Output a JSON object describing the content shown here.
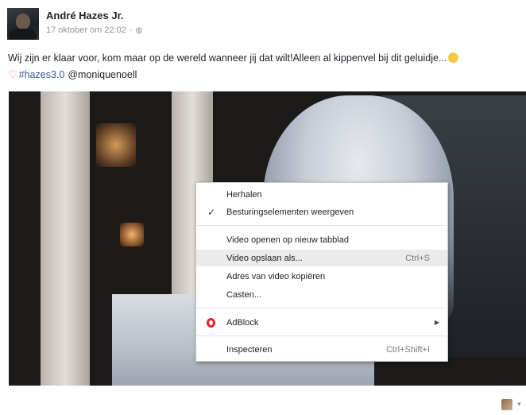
{
  "post": {
    "author": "André Hazes Jr.",
    "timestamp": "17 oktober om 22:02",
    "separator": "·",
    "text": "Wij zijn er klaar voor, kom maar op de wereld wanneer jij dat wilt!Alleen al kippenvel bij dit geluidje...",
    "hashtag": "#hazes3.0",
    "mention": "@moniquenoell"
  },
  "context_menu": {
    "items": [
      {
        "label": "Herhalen",
        "shortcut": "",
        "checked": false
      },
      {
        "label": "Besturingselementen weergeven",
        "shortcut": "",
        "checked": true
      },
      {
        "label": "Video openen op nieuw tabblad",
        "shortcut": ""
      },
      {
        "label": "Video opslaan als...",
        "shortcut": "Ctrl+S",
        "highlighted": true
      },
      {
        "label": "Adres van video kopiëren",
        "shortcut": ""
      },
      {
        "label": "Casten...",
        "shortcut": ""
      },
      {
        "label": "AdBlock",
        "shortcut": "",
        "submenu": true
      },
      {
        "label": "Inspecteren",
        "shortcut": "Ctrl+Shift+I"
      }
    ]
  },
  "icons": {
    "privacy": "globe-icon",
    "heart": "heart-icon",
    "emoji": "smiley-emoji-icon",
    "checked": "check-icon",
    "adblock": "opera-icon",
    "submenu": "arrow-right-icon"
  },
  "colors": {
    "link": "#365899",
    "heart": "#f0708a",
    "menu_highlight": "#ebebeb",
    "opera_red": "#e0262b"
  }
}
